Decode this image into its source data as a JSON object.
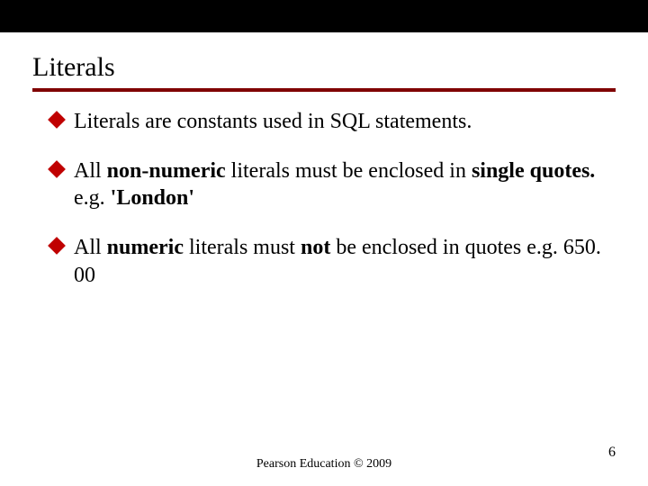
{
  "title": "Literals",
  "bullets": [
    {
      "segments": [
        {
          "t": "Literals are constants used in SQL statements.",
          "b": false
        }
      ]
    },
    {
      "segments": [
        {
          "t": "All ",
          "b": false
        },
        {
          "t": "non-numeric",
          "b": true
        },
        {
          "t": " literals must be enclosed in ",
          "b": false
        },
        {
          "t": "single quotes.",
          "b": true
        },
        {
          "t": " e.g. ",
          "b": false
        },
        {
          "t": "'London'",
          "b": true
        }
      ]
    },
    {
      "segments": [
        {
          "t": "All ",
          "b": false
        },
        {
          "t": "numeric",
          "b": true
        },
        {
          "t": " literals must ",
          "b": false
        },
        {
          "t": "not",
          "b": true
        },
        {
          "t": " be enclosed in quotes e.g. 650. 00",
          "b": false
        }
      ]
    }
  ],
  "footer": "Pearson Education © 2009",
  "page_number": "6"
}
